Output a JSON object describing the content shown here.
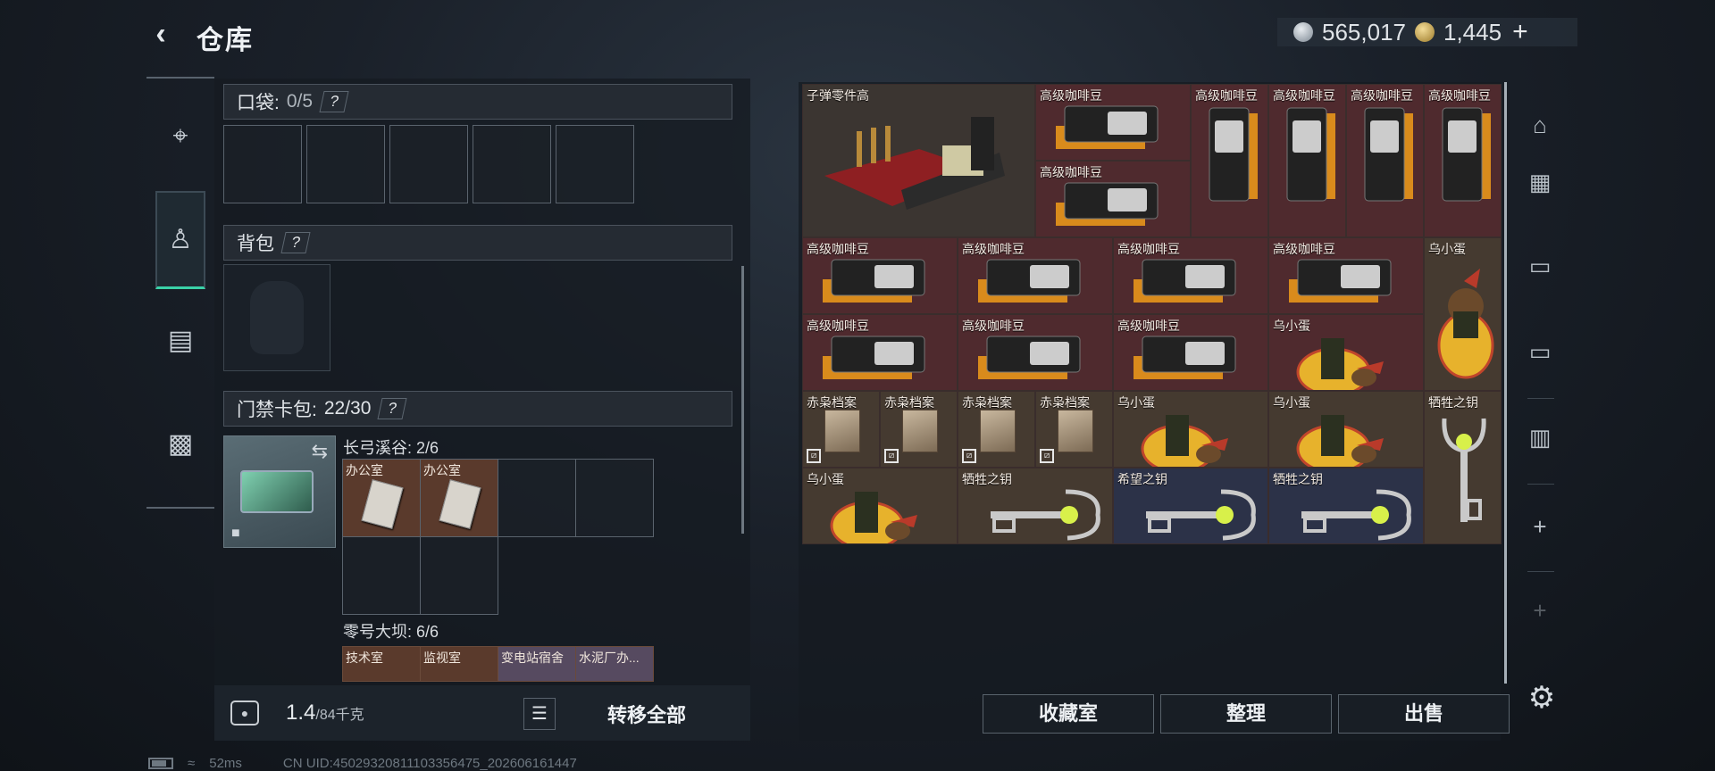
{
  "header": {
    "title": "仓库",
    "back_icon": "back-arrow-icon"
  },
  "currency": {
    "silver": "565,017",
    "gold": "1,445",
    "add_label": "+"
  },
  "left_tabs": [
    {
      "name": "weapons",
      "icon": "gun-icon",
      "glyph": "⌐"
    },
    {
      "name": "backpack",
      "icon": "backpack-icon",
      "glyph": "⛑"
    },
    {
      "name": "chest-rig",
      "icon": "chest-rig-icon",
      "glyph": "▤"
    },
    {
      "name": "toolbox",
      "icon": "toolbox-icon",
      "glyph": "▭"
    }
  ],
  "pocket": {
    "label": "口袋:",
    "count": "0/5",
    "help": "?"
  },
  "backpack": {
    "label": "背包",
    "help": "?"
  },
  "keycard_bag": {
    "label": "门禁卡包:",
    "count": "22/30",
    "help": "?"
  },
  "keycard_groups": [
    {
      "label": "长弓溪谷: 2/6",
      "slots": [
        "办公室",
        "办公室"
      ]
    },
    {
      "label": "零号大坝: 6/6",
      "slots": [
        "技术室",
        "监视室",
        "变电站宿舍",
        "水泥厂办..."
      ]
    }
  ],
  "footer": {
    "weight": "1.4",
    "capacity": "/84千克",
    "transfer_all": "转移全部",
    "list_icon": "list-icon",
    "weight_icon": "weight-icon"
  },
  "grid_items": [
    {
      "label": "子弹零件高",
      "kind": "ammo",
      "color": "dark"
    },
    {
      "label": "高级咖啡豆",
      "kind": "coffeeH",
      "color": "red"
    },
    {
      "label": "高级咖啡豆",
      "kind": "coffeeH",
      "color": "red"
    },
    {
      "label": "高级咖啡豆",
      "kind": "coffeeV",
      "color": "red"
    },
    {
      "label": "高级咖啡豆",
      "kind": "coffeeV",
      "color": "red"
    },
    {
      "label": "高级咖啡豆",
      "kind": "coffeeV",
      "color": "red"
    },
    {
      "label": "高级咖啡豆",
      "kind": "coffeeV",
      "color": "red"
    },
    {
      "label": "高级咖啡豆",
      "kind": "coffeeH",
      "color": "red"
    },
    {
      "label": "高级咖啡豆",
      "kind": "coffeeH",
      "color": "red"
    },
    {
      "label": "高级咖啡豆",
      "kind": "coffeeH",
      "color": "red"
    },
    {
      "label": "高级咖啡豆",
      "kind": "coffeeH",
      "color": "red"
    },
    {
      "label": "乌小蛋",
      "kind": "eggV",
      "color": "brown"
    },
    {
      "label": "高级咖啡豆",
      "kind": "coffeeH",
      "color": "red"
    },
    {
      "label": "高级咖啡豆",
      "kind": "coffeeH",
      "color": "red"
    },
    {
      "label": "高级咖啡豆",
      "kind": "coffeeH",
      "color": "red"
    },
    {
      "label": "乌小蛋",
      "kind": "egg",
      "color": "red"
    },
    {
      "label": "赤枭档案",
      "kind": "file",
      "color": "brown"
    },
    {
      "label": "赤枭档案",
      "kind": "file",
      "color": "brown"
    },
    {
      "label": "赤枭档案",
      "kind": "file",
      "color": "brown"
    },
    {
      "label": "赤枭档案",
      "kind": "file",
      "color": "brown"
    },
    {
      "label": "乌小蛋",
      "kind": "egg",
      "color": "brown"
    },
    {
      "label": "乌小蛋",
      "kind": "egg",
      "color": "brown"
    },
    {
      "label": "牺牲之钥",
      "kind": "keyV",
      "color": "brown"
    },
    {
      "label": "乌小蛋",
      "kind": "egg",
      "color": "brown"
    },
    {
      "label": "牺牲之钥",
      "kind": "keyH",
      "color": "brown"
    },
    {
      "label": "希望之钥",
      "kind": "keyH",
      "color": "blue"
    },
    {
      "label": "牺牲之钥",
      "kind": "keyH",
      "color": "blue"
    }
  ],
  "right_tools": [
    {
      "name": "storage-icon",
      "glyph": "⌂"
    },
    {
      "name": "frame-icon",
      "glyph": "▦"
    },
    {
      "name": "folder-iv-icon",
      "glyph": "▭"
    },
    {
      "name": "folder-add-iv-icon",
      "glyph": "▭"
    },
    {
      "name": "inventory-tool-icon",
      "glyph": "▥"
    },
    {
      "name": "add-tab-icon",
      "glyph": "+"
    },
    {
      "name": "add-tab-icon-2",
      "glyph": "+"
    }
  ],
  "bottom_buttons": {
    "collection": "收藏室",
    "sort": "整理",
    "sell": "出售"
  },
  "settings_icon": "gear-icon",
  "status": {
    "ping": "52ms",
    "uid": "CN UID:450293208111033564​75_202606161447"
  },
  "colors": {
    "accent": "#3ad1a8",
    "red_slot": "#4f2a2e",
    "blue_slot": "#2c3248"
  }
}
